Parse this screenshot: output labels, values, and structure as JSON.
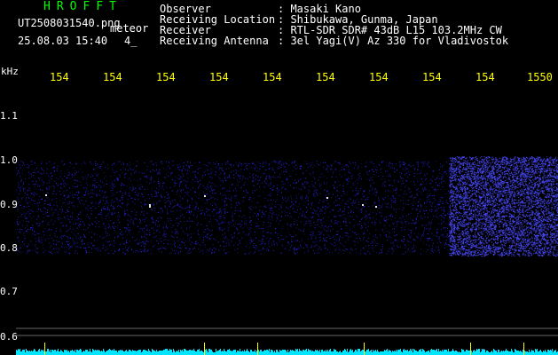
{
  "header": {
    "brand": "HROFFT",
    "filename": "UT2508031540.png",
    "mode": "meteor",
    "datetime": "25.08.03 15:40",
    "count": "4_"
  },
  "station": [
    {
      "label": "Observer",
      "value": ": Masaki Kano"
    },
    {
      "label": "Receiving Location",
      "value": ": Shibukawa, Gunma, Japan"
    },
    {
      "label": "Receiver",
      "value": ": RTL-SDR SDR# 43dB L15 103.2MHz CW"
    },
    {
      "label": "Receiving Antenna",
      "value": ": 3el Yagi(V) Az 330 for Vladivostok"
    }
  ],
  "axes": {
    "freq_unit": "kHz",
    "time_ticks": [
      "154",
      "154",
      "154",
      "154",
      "154",
      "154",
      "154",
      "154",
      "154",
      "1550"
    ],
    "freq_ticks": [
      "1.1",
      "1.0",
      "0.9",
      "0.8",
      "0.7",
      "0.6"
    ]
  },
  "colors": {
    "background": "#000000",
    "noise": "#2a2aff",
    "echo": "#ffffff",
    "baseline": "#00e5ff",
    "marker": "#ffff00"
  }
}
